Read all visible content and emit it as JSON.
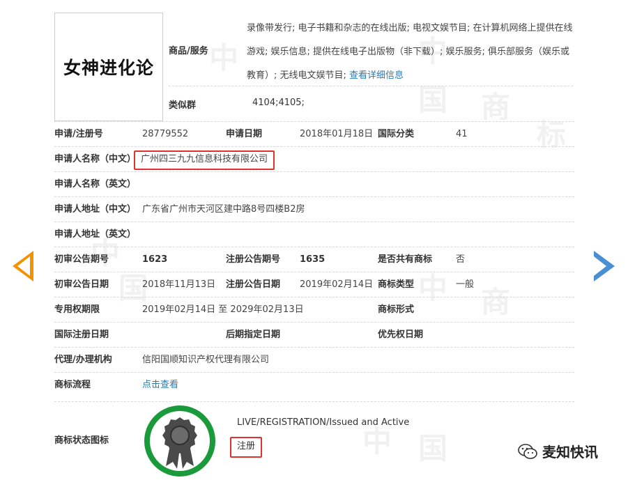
{
  "trademark": {
    "name": "女神进化论",
    "goods_label": "商品/服务",
    "goods_text": "录像带发行; 电子书籍和杂志的在线出版; 电视文娱节目; 在计算机网络上提供在线游戏; 娱乐信息; 提供在线电子出版物（非下载）; 娱乐服务; 俱乐部服务（娱乐或教育）; 无线电文娱节目; ",
    "goods_link": "查看详细信息",
    "similar_label": "类似群",
    "similar_value": "4104;4105;"
  },
  "details": {
    "reg_no_label": "申请/注册号",
    "reg_no": "28779552",
    "apply_date_label": "申请日期",
    "apply_date": "2018年01月18日",
    "intl_class_label": "国际分类",
    "intl_class": "41",
    "applicant_cn_label": "申请人名称（中文）",
    "applicant_cn": "广州四三九九信息科技有限公司",
    "applicant_en_label": "申请人名称（英文）",
    "address_cn_label": "申请人地址（中文）",
    "address_cn": "广东省广州市天河区建中路8号四楼B2房",
    "address_en_label": "申请人地址（英文）",
    "prelim_no_label": "初审公告期号",
    "prelim_no": "1623",
    "reg_pub_no_label": "注册公告期号",
    "reg_pub_no": "1635",
    "shared_label": "是否共有商标",
    "shared": "否",
    "prelim_date_label": "初审公告日期",
    "prelim_date": "2018年11月13日",
    "reg_pub_date_label": "注册公告日期",
    "reg_pub_date": "2019年02月14日",
    "tm_type_label": "商标类型",
    "tm_type": "一般",
    "exclusive_label": "专用权期限",
    "exclusive": "2019年02月14日 至 2029年02月13日",
    "tm_form_label": "商标形式",
    "intl_reg_date_label": "国际注册日期",
    "later_date_label": "后期指定日期",
    "priority_date_label": "优先权日期",
    "agent_label": "代理/办理机构",
    "agent": "信阳国顺知识产权代理有限公司",
    "flow_label": "商标流程",
    "flow_link": "点击查看"
  },
  "status": {
    "label": "商标状态图标",
    "en": "LIVE/REGISTRATION/Issued and Active",
    "cn": "注册"
  },
  "watermark": {
    "chars": [
      "中",
      "国",
      "商",
      "标"
    ],
    "account": "麦知快讯"
  },
  "colors": {
    "highlight_red": "#e0312c",
    "link_blue": "#2a7ab0",
    "prev_arrow": "#f39200",
    "next_arrow": "#4a8fd4",
    "seal_green": "#1a9a3a"
  }
}
